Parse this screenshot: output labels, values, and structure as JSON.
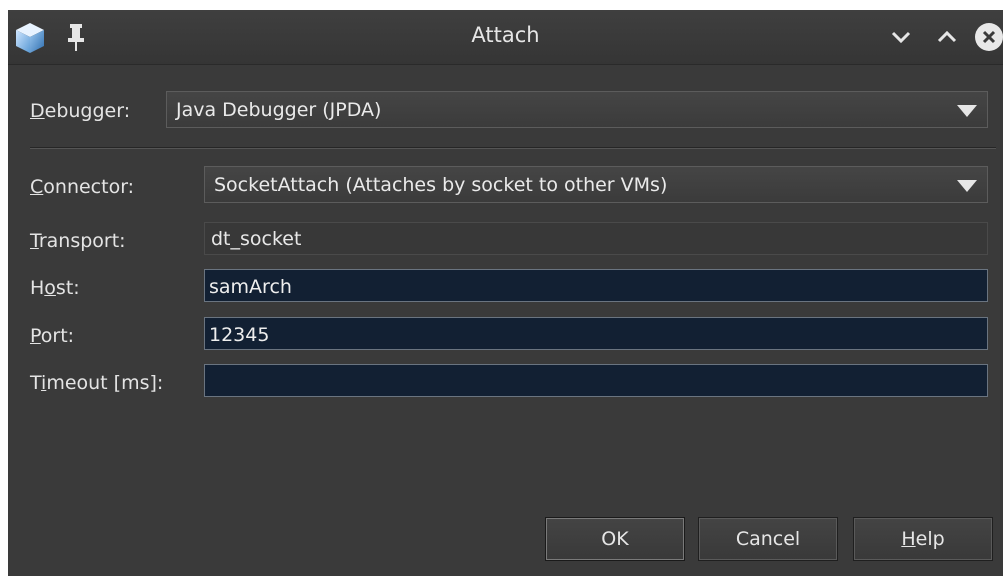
{
  "window": {
    "title": "Attach",
    "icons": {
      "app": "netbeans-cube-icon",
      "pin": "pin-icon",
      "minimize": "chevron-down-icon",
      "maximize": "chevron-up-icon",
      "close": "close-icon"
    }
  },
  "form": {
    "debugger": {
      "label_u": "D",
      "label_rest": "ebugger:",
      "value": "Java Debugger (JPDA)"
    },
    "connector": {
      "label_u": "C",
      "label_rest": "onnector:",
      "value": "SocketAttach (Attaches by socket to other VMs)"
    },
    "transport": {
      "label_u": "T",
      "label_rest": "ransport:",
      "value": "dt_socket"
    },
    "host": {
      "label_pre": "H",
      "label_u": "o",
      "label_rest": "st:",
      "value": "samArch"
    },
    "port": {
      "label_u": "P",
      "label_rest": "ort:",
      "value": "12345"
    },
    "timeout": {
      "label_pre": "T",
      "label_u": "i",
      "label_rest": "meout [ms]:",
      "value": ""
    }
  },
  "buttons": {
    "ok": "OK",
    "cancel": "Cancel",
    "help_u": "H",
    "help_rest": "elp"
  },
  "colors": {
    "window_bg": "#3a3a3a",
    "field_bg": "#122033",
    "text": "#e8e8e8"
  }
}
